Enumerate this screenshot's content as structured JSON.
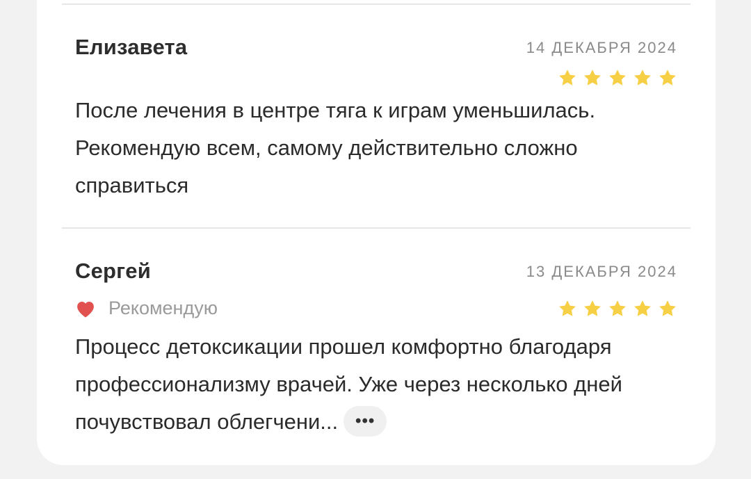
{
  "reviews": [
    {
      "author": "Елизавета",
      "date": "14 ДЕКАБРЯ 2024",
      "rating": 5,
      "text": "После лечения в центре тяга к играм уменьшилась. Рекомендую всем, самому действительно сложно справиться"
    },
    {
      "author": "Сергей",
      "date": "13 ДЕКАБРЯ 2024",
      "rating": 5,
      "recommend_label": "Рекомендую",
      "text": "Процесс детоксикации прошел комфортно благодаря профессионализму врачей. Уже через несколько дней почувствовал облегчени...",
      "more_label": "•••"
    }
  ],
  "colors": {
    "star": "#f7cf45",
    "heart": "#e0514f",
    "background": "#f2f2f2",
    "card": "#ffffff"
  },
  "icons": {
    "star": "star-icon",
    "heart": "heart-icon",
    "more": "more-dots-icon"
  }
}
